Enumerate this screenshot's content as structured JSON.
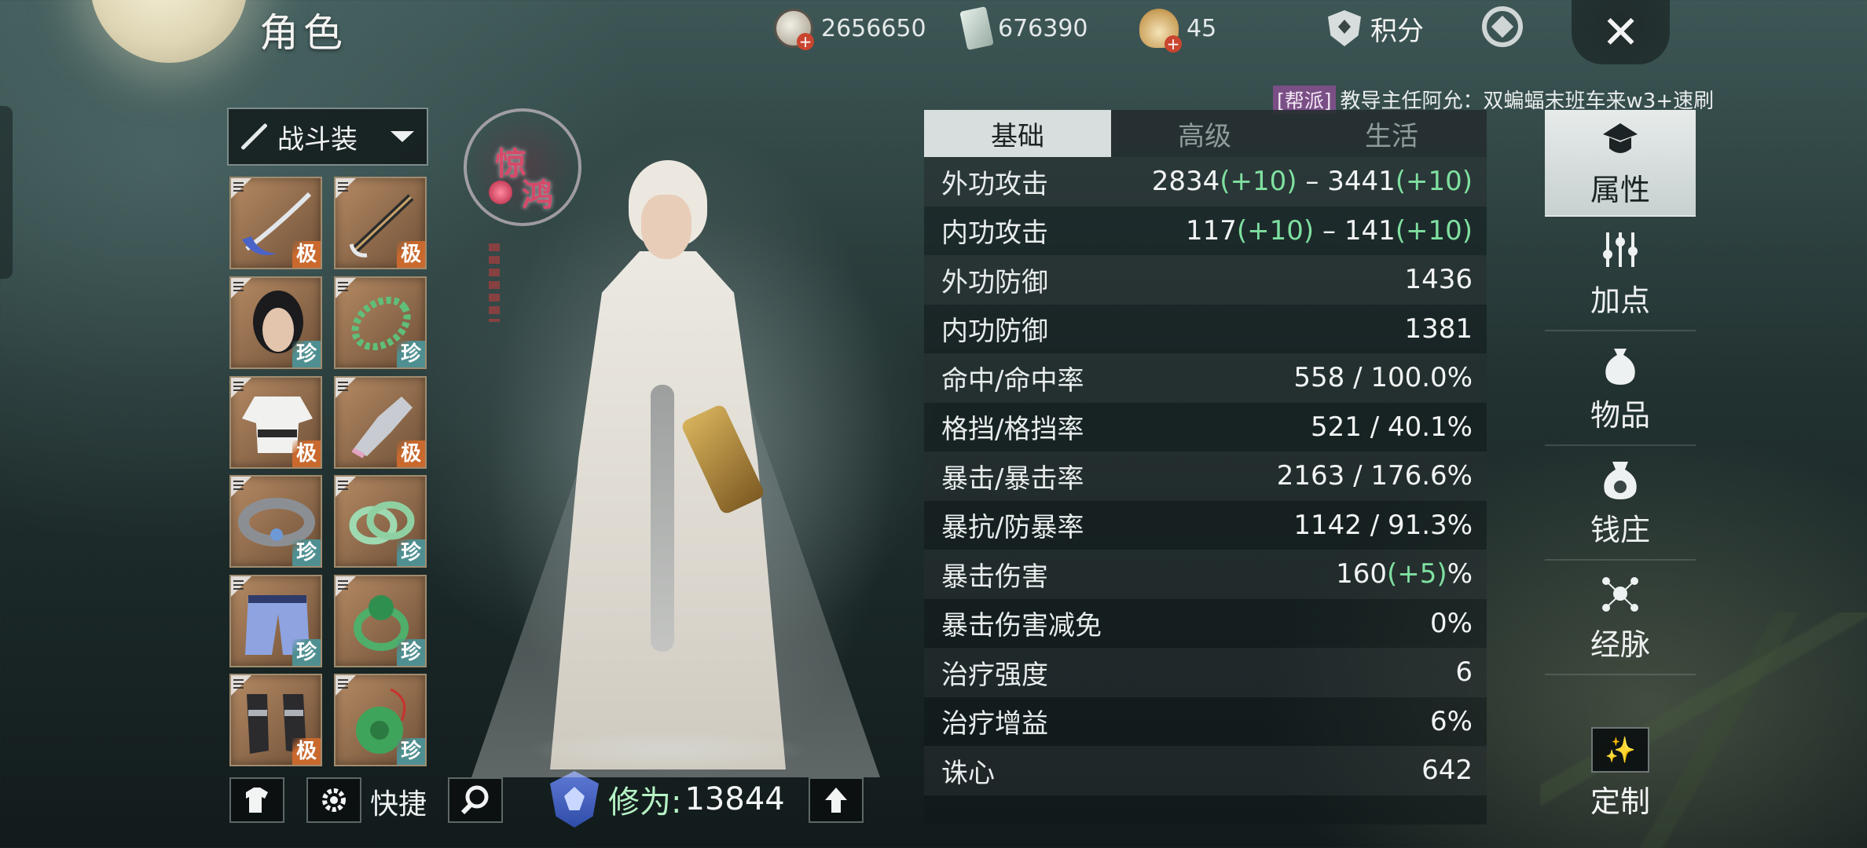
{
  "header": {
    "title": "角色",
    "currencies": [
      {
        "icon": "silver-coin-icon",
        "value": "2656650"
      },
      {
        "icon": "ticket-icon",
        "value": "676390"
      },
      {
        "icon": "pouch-icon",
        "value": "45"
      }
    ],
    "score_label": "积分"
  },
  "chat": {
    "channel": "[帮派]",
    "message": "教导主任阿允：双蝙蝠末班车来w3+速刷"
  },
  "outfit": {
    "selected": "战斗装"
  },
  "title_badge": {
    "char1": "惊",
    "char2": "鸿"
  },
  "equipment": [
    {
      "name": "scythe-weapon",
      "grade": "极"
    },
    {
      "name": "fan-weapon",
      "grade": "极"
    },
    {
      "name": "head-appearance",
      "grade": "珍"
    },
    {
      "name": "jade-necklace",
      "grade": "珍"
    },
    {
      "name": "white-robe",
      "grade": "极"
    },
    {
      "name": "gauntlet",
      "grade": "极"
    },
    {
      "name": "belt",
      "grade": "珍"
    },
    {
      "name": "jade-bracelet",
      "grade": "珍"
    },
    {
      "name": "leg-armor",
      "grade": "珍"
    },
    {
      "name": "jade-ring",
      "grade": "珍"
    },
    {
      "name": "boots",
      "grade": "极"
    },
    {
      "name": "jade-pendant",
      "grade": "珍"
    }
  ],
  "bottom": {
    "quick_label": "快捷",
    "cultivation_label": "修为:",
    "cultivation_value": "13844"
  },
  "stats": {
    "tabs": [
      "基础",
      "高级",
      "生活"
    ],
    "active_tab": 0,
    "rows": [
      {
        "name": "外功攻击",
        "v1": "2834",
        "b1": "(+10)",
        "sep": " – ",
        "v2": "3441",
        "b2": "(+10)",
        "tail": ""
      },
      {
        "name": "内功攻击",
        "v1": "117",
        "b1": "(+10)",
        "sep": " – ",
        "v2": "141",
        "b2": "(+10)",
        "tail": ""
      },
      {
        "name": "外功防御",
        "v1": "1436",
        "b1": "",
        "sep": "",
        "v2": "",
        "b2": "",
        "tail": ""
      },
      {
        "name": "内功防御",
        "v1": "1381",
        "b1": "",
        "sep": "",
        "v2": "",
        "b2": "",
        "tail": ""
      },
      {
        "name": "命中/命中率",
        "v1": "558 / 100.0%",
        "b1": "",
        "sep": "",
        "v2": "",
        "b2": "",
        "tail": ""
      },
      {
        "name": "格挡/格挡率",
        "v1": "521 / 40.1%",
        "b1": "",
        "sep": "",
        "v2": "",
        "b2": "",
        "tail": ""
      },
      {
        "name": "暴击/暴击率",
        "v1": "2163 / 176.6%",
        "b1": "",
        "sep": "",
        "v2": "",
        "b2": "",
        "tail": ""
      },
      {
        "name": "暴抗/防暴率",
        "v1": "1142 / 91.3%",
        "b1": "",
        "sep": "",
        "v2": "",
        "b2": "",
        "tail": ""
      },
      {
        "name": "暴击伤害",
        "v1": "160",
        "b1": "(+5)",
        "sep": "",
        "v2": "",
        "b2": "",
        "tail": "%"
      },
      {
        "name": "暴击伤害减免",
        "v1": "0%",
        "b1": "",
        "sep": "",
        "v2": "",
        "b2": "",
        "tail": ""
      },
      {
        "name": "治疗强度",
        "v1": "6",
        "b1": "",
        "sep": "",
        "v2": "",
        "b2": "",
        "tail": ""
      },
      {
        "name": "治疗增益",
        "v1": "6%",
        "b1": "",
        "sep": "",
        "v2": "",
        "b2": "",
        "tail": ""
      },
      {
        "name": "诛心",
        "v1": "642",
        "b1": "",
        "sep": "",
        "v2": "",
        "b2": "",
        "tail": ""
      }
    ]
  },
  "nav": {
    "items": [
      {
        "label": "属性",
        "icon": "attribute-hat-icon"
      },
      {
        "label": "加点",
        "icon": "sliders-icon"
      },
      {
        "label": "物品",
        "icon": "bag-icon"
      },
      {
        "label": "钱庄",
        "icon": "money-bag-icon"
      },
      {
        "label": "经脉",
        "icon": "meridian-icon"
      }
    ],
    "active": 0,
    "custom_label": "定制"
  },
  "colors": {
    "bonus_green": "#7fe0a0",
    "grade_ji": "#c9692e",
    "grade_zhen": "#4f8f91",
    "guild_tag": "#7a4f86"
  }
}
